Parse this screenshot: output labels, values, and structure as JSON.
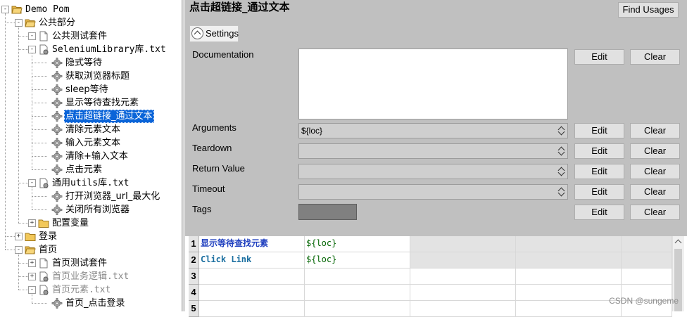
{
  "tree": [
    {
      "label": "Demo Pom",
      "depth": 0,
      "kind": "folder-open",
      "exp": "-",
      "mono": true
    },
    {
      "label": "公共部分",
      "depth": 1,
      "kind": "folder-open",
      "exp": "-"
    },
    {
      "label": "公共测试套件",
      "depth": 2,
      "kind": "file",
      "exp": "-"
    },
    {
      "label": "SeleniumLibrary库.txt",
      "depth": 2,
      "kind": "resource",
      "exp": "-",
      "mono": true
    },
    {
      "label": "隐式等待",
      "depth": 3,
      "kind": "gear"
    },
    {
      "label": "获取浏览器标题",
      "depth": 3,
      "kind": "gear"
    },
    {
      "label": "sleep等待",
      "depth": 3,
      "kind": "gear"
    },
    {
      "label": "显示等待查找元素",
      "depth": 3,
      "kind": "gear"
    },
    {
      "label": "点击超链接_通过文本",
      "depth": 3,
      "kind": "gear",
      "selected": true
    },
    {
      "label": "清除元素文本",
      "depth": 3,
      "kind": "gear"
    },
    {
      "label": "输入元素文本",
      "depth": 3,
      "kind": "gear"
    },
    {
      "label": "清除+输入文本",
      "depth": 3,
      "kind": "gear"
    },
    {
      "label": "点击元素",
      "depth": 3,
      "kind": "gear"
    },
    {
      "label": "通用utils库.txt",
      "depth": 2,
      "kind": "resource",
      "exp": "-",
      "mono": true
    },
    {
      "label": "打开浏览器_url_最大化",
      "depth": 3,
      "kind": "gear"
    },
    {
      "label": "关闭所有浏览器",
      "depth": 3,
      "kind": "gear"
    },
    {
      "label": "配置变量",
      "depth": 2,
      "kind": "folder-closed",
      "exp": "+"
    },
    {
      "label": "登录",
      "depth": 1,
      "kind": "folder-closed",
      "exp": "+"
    },
    {
      "label": "首页",
      "depth": 1,
      "kind": "folder-open",
      "exp": "-"
    },
    {
      "label": "首页测试套件",
      "depth": 2,
      "kind": "file",
      "exp": "+"
    },
    {
      "label": "首页业务逻辑.txt",
      "depth": 2,
      "kind": "resource",
      "exp": "+",
      "mono": true,
      "dim": true
    },
    {
      "label": "首页元素.txt",
      "depth": 2,
      "kind": "resource",
      "exp": "-",
      "mono": true,
      "dim": true
    },
    {
      "label": "首页_点击登录",
      "depth": 3,
      "kind": "gear"
    }
  ],
  "editor": {
    "title": "点击超链接_通过文本",
    "find_usages": "Find Usages",
    "settings": "Settings",
    "edit": "Edit",
    "clear": "Clear",
    "documentation_label": "Documentation",
    "documentation_value": "",
    "fields": [
      {
        "label": "Arguments",
        "value": "${loc}"
      },
      {
        "label": "Teardown",
        "value": ""
      },
      {
        "label": "Return Value",
        "value": ""
      },
      {
        "label": "Timeout",
        "value": ""
      }
    ],
    "tags_label": "Tags"
  },
  "grid": {
    "rows": [
      {
        "num": "1",
        "keyword": "显示等待查找元素",
        "arg": "${loc}"
      },
      {
        "num": "2",
        "keyword": "Click Link",
        "arg": "${loc}"
      },
      {
        "num": "3",
        "keyword": "",
        "arg": ""
      },
      {
        "num": "4",
        "keyword": "",
        "arg": ""
      },
      {
        "num": "5",
        "keyword": "",
        "arg": ""
      }
    ]
  },
  "watermark": "CSDN @sungeme",
  "colors": {
    "selection": "#0a64d8",
    "keyword": "#1f3fbf",
    "argument": "#006400",
    "panel": "#c0c0c0"
  }
}
